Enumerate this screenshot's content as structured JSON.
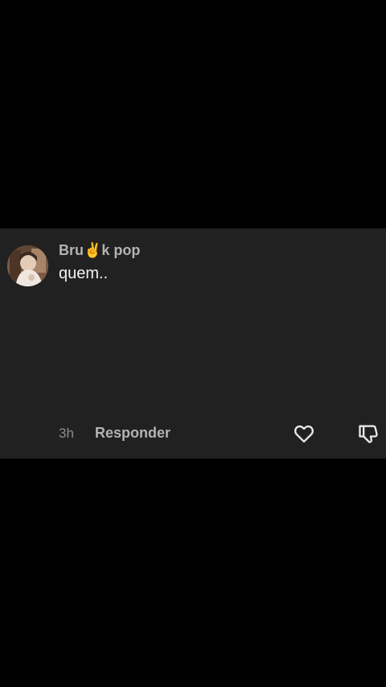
{
  "comment": {
    "username": "Bru✌️k pop",
    "text": "quem..",
    "timestamp": "3h",
    "reply_label": "Responder",
    "icons": {
      "like": "heart-outline-icon",
      "dislike": "thumbs-down-outline-icon"
    }
  },
  "colors": {
    "background": "#000000",
    "card": "#212121",
    "username": "#b3b3b3",
    "text": "#f2f2f2",
    "meta": "#8c8c8c"
  }
}
